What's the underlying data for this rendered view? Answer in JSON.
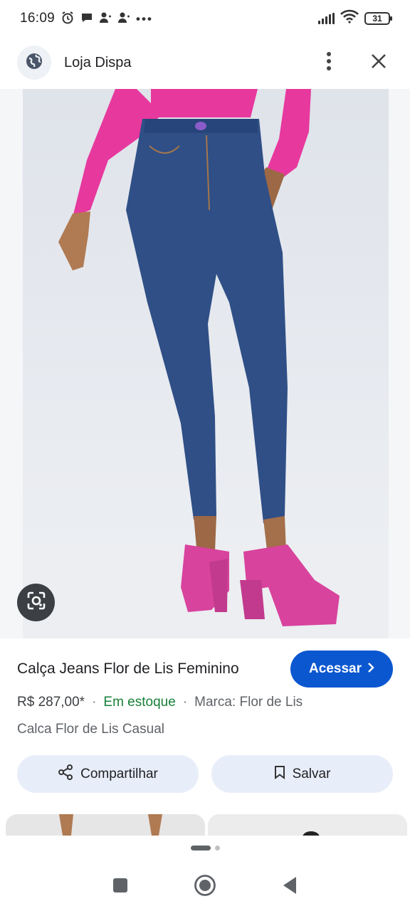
{
  "status_bar": {
    "time": "16:09",
    "battery": "31"
  },
  "header": {
    "title": "Loja Dispa"
  },
  "product": {
    "title": "Calça Jeans Flor de Lis Feminino",
    "access_label": "Acessar",
    "price": "R$ 287,00*",
    "stock": "Em estoque",
    "brand": "Marca: Flor de Lis",
    "subtitle": "Calca Flor de Lis Casual"
  },
  "actions": {
    "share_label": "Compartilhar",
    "save_label": "Salvar"
  },
  "colors": {
    "accent": "#0b57d0",
    "stock_green": "#188038",
    "pill_bg": "#e8eef9",
    "top_pink": "#e7389e",
    "denim": "#2f4f86",
    "shoe_pink": "#d8439d"
  },
  "icons": {
    "status": [
      "alarm-icon",
      "chat-icon",
      "person-icon",
      "person-icon",
      "more-dots-icon",
      "signal-icon",
      "wifi-icon",
      "battery-icon"
    ],
    "header": [
      "globe-icon",
      "more-vert-icon",
      "close-icon"
    ],
    "nav": [
      "square-icon",
      "home-circle-icon",
      "back-triangle-icon"
    ]
  }
}
